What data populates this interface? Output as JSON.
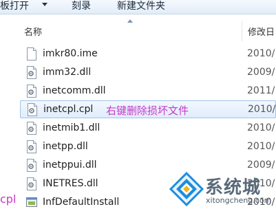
{
  "toolbar": {
    "open_label": "板打开",
    "burn_label": "刻录",
    "new_folder_label": "新建文件夹"
  },
  "left_pane": {
    "partial_text": "cpl"
  },
  "columns": {
    "name": "名称",
    "date": "修改日"
  },
  "files": [
    {
      "name": "imkr80.ime",
      "date": "2010/",
      "icon": "generic-file-icon"
    },
    {
      "name": "imm32.dll",
      "date": "2009/",
      "icon": "dll-file-icon"
    },
    {
      "name": "inetcomm.dll",
      "date": "2011/",
      "icon": "dll-file-icon"
    },
    {
      "name": "inetcpl.cpl",
      "date": "2010/",
      "icon": "dll-file-icon",
      "selected": true,
      "annotation": "右键删除损坏文件"
    },
    {
      "name": "inetmib1.dll",
      "date": "2010/",
      "icon": "dll-file-icon"
    },
    {
      "name": "inetpp.dll",
      "date": "2010/",
      "icon": "dll-file-icon"
    },
    {
      "name": "inetppui.dll",
      "date": "2009/",
      "icon": "dll-file-icon"
    },
    {
      "name": "INETRES.dll",
      "date": "2010/",
      "icon": "dll-file-icon"
    },
    {
      "name": "InfDefaultInstall",
      "date": "2010/",
      "icon": "exe-file-icon"
    }
  ],
  "watermark": {
    "brand": "系统城",
    "url": "xitongcheng.com"
  },
  "colors": {
    "annotation": "#c837c8",
    "selection_border": "#9fc4ea",
    "logo_blue": "#1c8de0"
  }
}
